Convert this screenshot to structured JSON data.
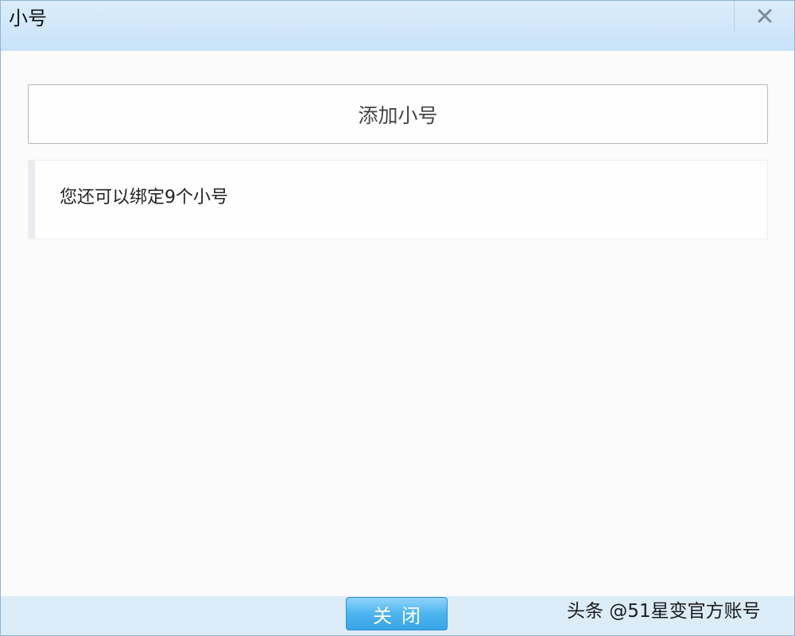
{
  "window": {
    "title": "小号",
    "close_icon": "close-icon"
  },
  "main": {
    "add_button_label": "添加小号",
    "info_text": "您还可以绑定9个小号"
  },
  "footer": {
    "close_label": "关闭"
  },
  "watermark": {
    "text": "头条 @51星变官方账号"
  },
  "colors": {
    "title_bar": "#c9e2f8",
    "footer_bar": "#dcecf9",
    "close_button": "#4cb4ef"
  }
}
